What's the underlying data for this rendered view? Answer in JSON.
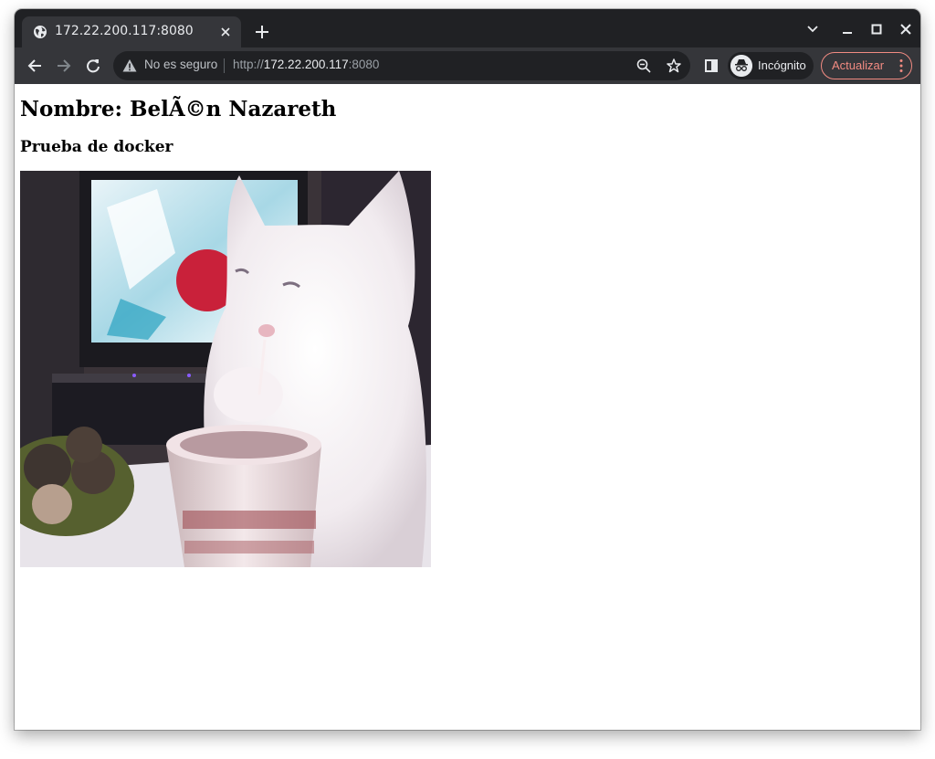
{
  "tab": {
    "title": "172.22.200.117:8080",
    "favicon": "globe-icon"
  },
  "window_controls": [
    "tab-search-icon",
    "minimize-icon",
    "maximize-icon",
    "close-icon"
  ],
  "toolbar": {
    "back": "back-arrow-icon",
    "forward": "forward-arrow-icon",
    "reload": "reload-icon"
  },
  "omnibox": {
    "security_label": "No es seguro",
    "url_scheme": "http://",
    "url_host": "172.22.200.117",
    "url_port": ":8080",
    "zoom_icon": "zoom-out-icon",
    "bookmark_icon": "star-icon"
  },
  "incognito": {
    "label": "Incógnito"
  },
  "update": {
    "label": "Actualizar"
  },
  "colors": {
    "accent_update": "#f28b82",
    "frame": "#202124",
    "toolbar": "#35363a"
  },
  "page": {
    "heading": "Nombre: BelÃ©n Nazareth",
    "subheading": "Prueba de docker"
  }
}
